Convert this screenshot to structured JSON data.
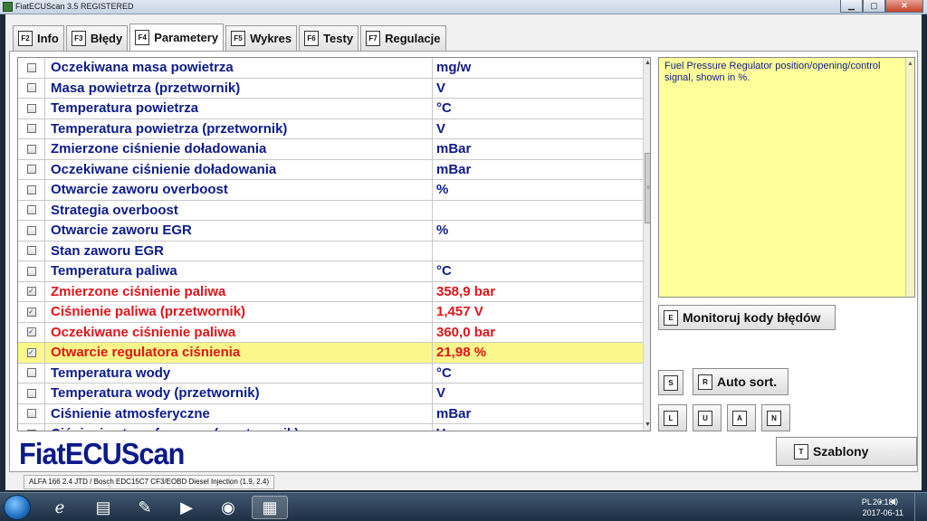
{
  "window": {
    "title": "FiatECUScan 3.5 REGISTERED",
    "minimize": "▁",
    "maximize": "▢",
    "close": "✕"
  },
  "tabs": [
    {
      "key": "F2",
      "label": "Info"
    },
    {
      "key": "F3",
      "label": "Błędy"
    },
    {
      "key": "F4",
      "label": "Parametery",
      "active": true
    },
    {
      "key": "F5",
      "label": "Wykres"
    },
    {
      "key": "F6",
      "label": "Testy"
    },
    {
      "key": "F7",
      "label": "Regulacje"
    }
  ],
  "parameters": [
    {
      "name": "Oczekiwana masa powietrza",
      "unit": "mg/w",
      "checked": false
    },
    {
      "name": "Masa powietrza (przetwornik)",
      "unit": "V",
      "checked": false
    },
    {
      "name": "Temperatura powietrza",
      "unit": "°C",
      "checked": false
    },
    {
      "name": "Temperatura powietrza (przetwornik)",
      "unit": "V",
      "checked": false
    },
    {
      "name": "Zmierzone ciśnienie doładowania",
      "unit": "mBar",
      "checked": false
    },
    {
      "name": "Oczekiwane ciśnienie doładowania",
      "unit": "mBar",
      "checked": false
    },
    {
      "name": "Otwarcie zaworu overboost",
      "unit": "%",
      "checked": false
    },
    {
      "name": "Strategia overboost",
      "unit": "",
      "checked": false
    },
    {
      "name": "Otwarcie zaworu EGR",
      "unit": "%",
      "checked": false
    },
    {
      "name": "Stan zaworu EGR",
      "unit": "",
      "checked": false
    },
    {
      "name": "Temperatura paliwa",
      "unit": "°C",
      "checked": false
    },
    {
      "name": "Zmierzone ciśnienie paliwa",
      "unit": "358,9 bar",
      "checked": true
    },
    {
      "name": "Ciśnienie paliwa (przetwornik)",
      "unit": "1,457 V",
      "checked": true
    },
    {
      "name": "Oczekiwane ciśnienie paliwa",
      "unit": "360,0 bar",
      "checked": true
    },
    {
      "name": "Otwarcie regulatora ciśnienia",
      "unit": "21,98 %",
      "checked": true,
      "highlighted": true
    },
    {
      "name": "Temperatura wody",
      "unit": "°C",
      "checked": false
    },
    {
      "name": "Temperatura wody (przetwornik)",
      "unit": "V",
      "checked": false
    },
    {
      "name": "Ciśnienie atmosferyczne",
      "unit": "mBar",
      "checked": false
    },
    {
      "name": "Ciśnienie atmosferyczne (przetwornik)",
      "unit": "V",
      "checked": false
    }
  ],
  "description": "Fuel Pressure Regulator position/opening/control signal, shown in %.",
  "buttons": {
    "monitor": {
      "key": "E",
      "label": "Monitoruj kody błędów"
    },
    "s": {
      "key": "S"
    },
    "autosort": {
      "key": "R",
      "label": "Auto sort."
    },
    "l": {
      "key": "L"
    },
    "u": {
      "key": "U"
    },
    "a": {
      "key": "A"
    },
    "n": {
      "key": "N"
    },
    "templates": {
      "key": "T",
      "label": "Szablony"
    }
  },
  "logo": "FiatECUScan",
  "status": "ALFA 166 2.4 JTD / Bosch EDC15C7 CF3/EOBD Diesel Injection (1.9, 2.4)",
  "taskbar": {
    "lang": "PL",
    "time": "20:18",
    "date": "2017-06-11"
  },
  "colors": {
    "accent_text": "#0e1b8c",
    "selected_text": "#e2141a",
    "highlight_row": "#fbf78a",
    "description_bg": "#ffff99"
  }
}
